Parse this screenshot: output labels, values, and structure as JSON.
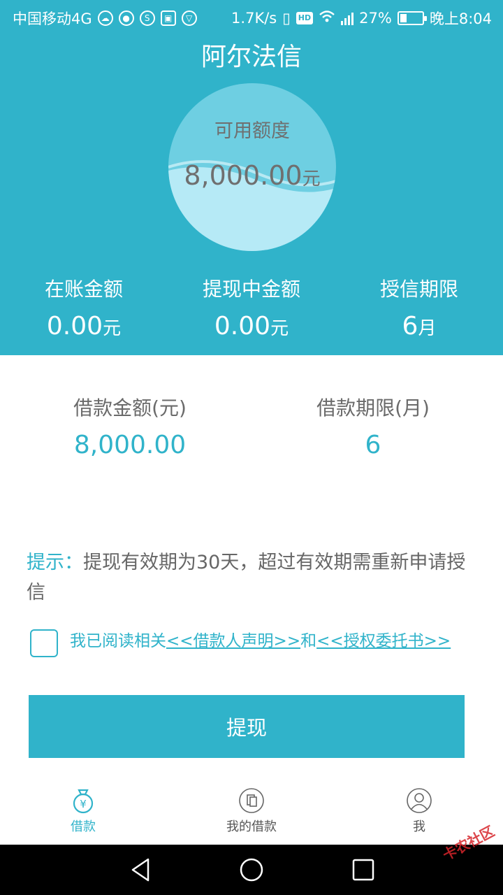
{
  "status_bar": {
    "carrier": "中国移动4G",
    "speed": "1.7K/s",
    "network": "4G",
    "battery": "27%",
    "time": "晚上8:04"
  },
  "app": {
    "title": "阿尔法信"
  },
  "credit": {
    "label": "可用额度",
    "amount": "8,000.00",
    "unit": "元"
  },
  "stats": [
    {
      "label": "在账金额",
      "value": "0.00",
      "unit": "元"
    },
    {
      "label": "提现中金额",
      "value": "0.00",
      "unit": "元"
    },
    {
      "label": "授信期限",
      "value": "6",
      "unit": "月"
    }
  ],
  "loan": {
    "amount_label": "借款金额(元)",
    "amount_value": "8,000.00",
    "term_label": "借款期限(月)",
    "term_value": "6"
  },
  "tip": {
    "label": "提示：",
    "text": "提现有效期为30天，超过有效期需重新申请授信"
  },
  "agreement": {
    "checked": false,
    "prefix": "我已阅读相关",
    "link1": "<<借款人声明>>",
    "joiner": "和",
    "link2": "<<授权委托书>>"
  },
  "submit_label": "提现",
  "tabs": [
    {
      "label": "借款",
      "icon": "money-bag-icon",
      "active": true
    },
    {
      "label": "我的借款",
      "icon": "document-icon",
      "active": false
    },
    {
      "label": "我",
      "icon": "user-icon",
      "active": false
    }
  ],
  "watermark": "卡农社区",
  "colors": {
    "primary": "#30b3ca",
    "text": "#666666",
    "nav": "#000000"
  }
}
